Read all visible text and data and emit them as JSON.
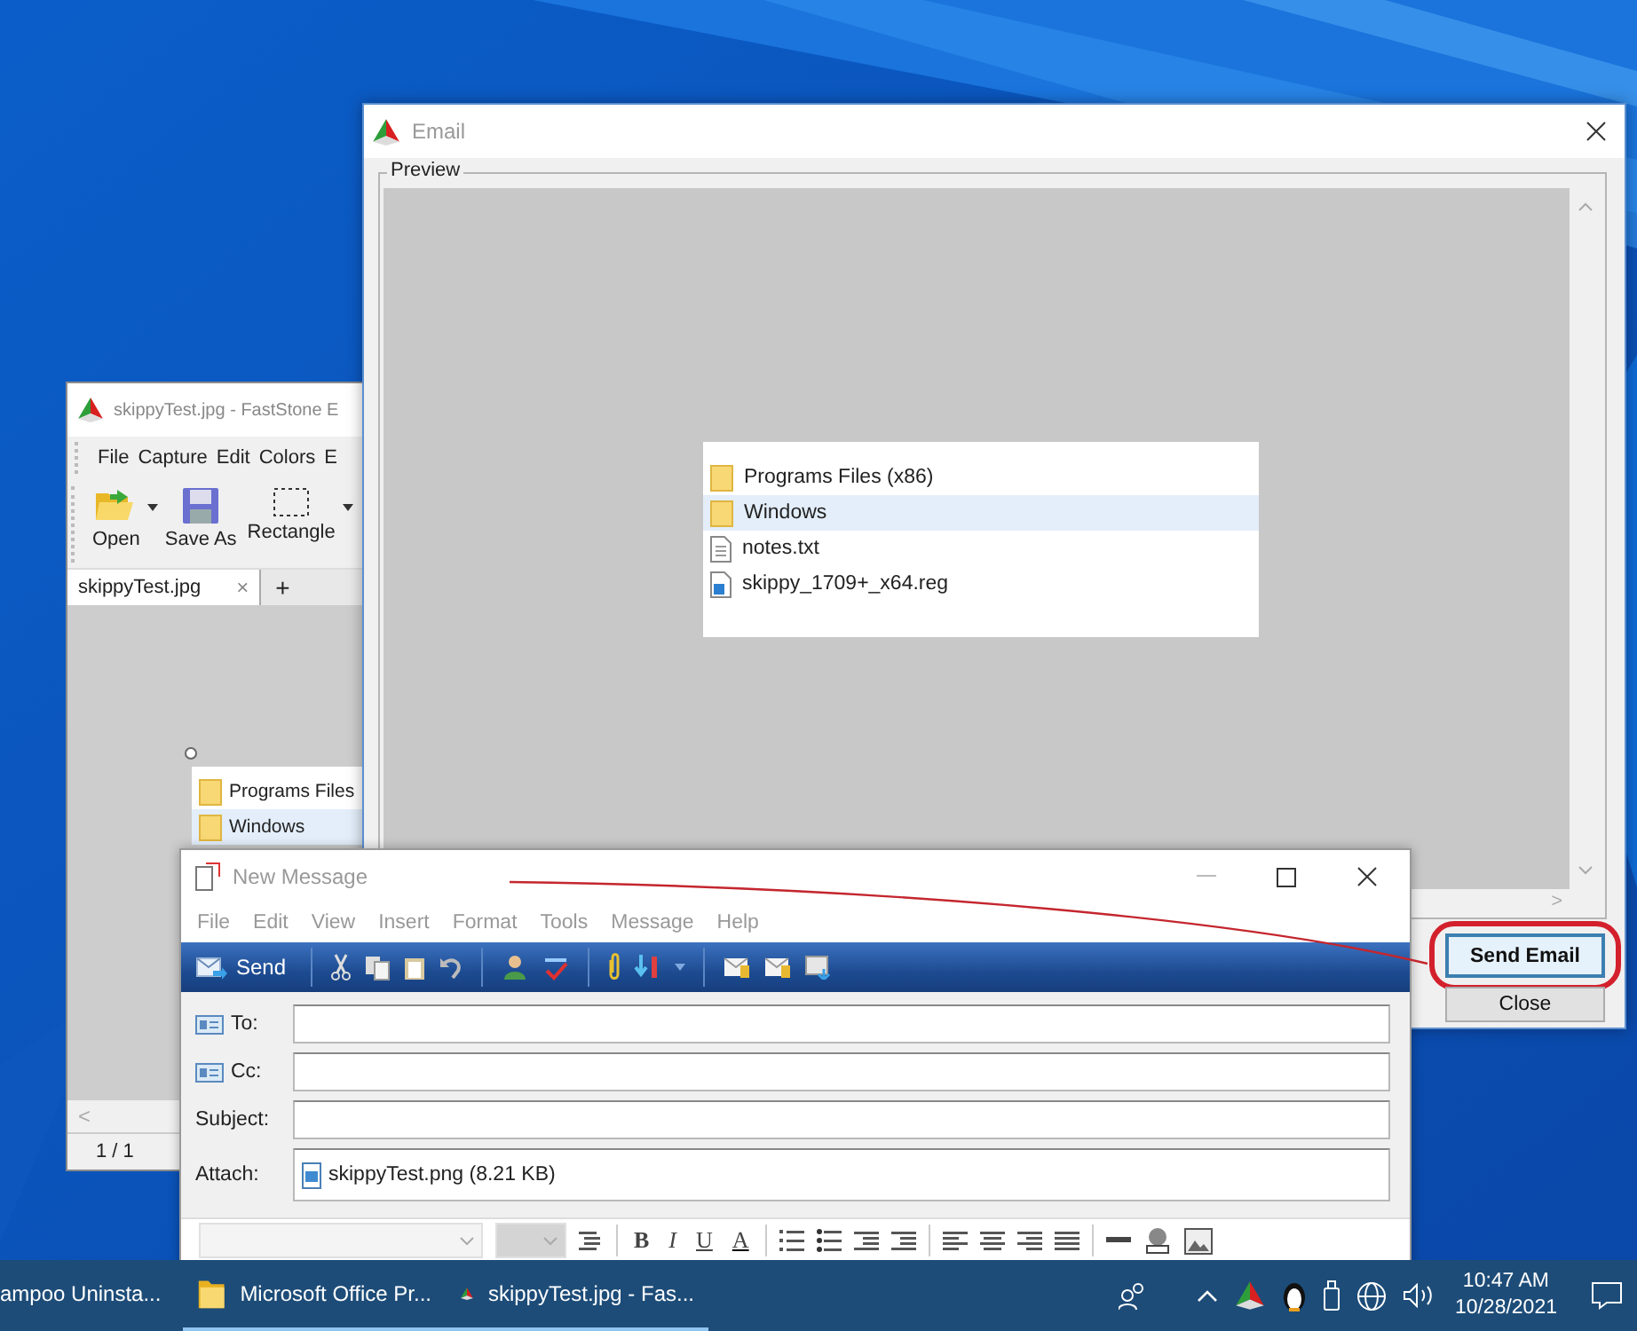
{
  "faststone_window": {
    "title": "skippyTest.jpg - FastStone E",
    "menu": [
      "File",
      "Capture",
      "Edit",
      "Colors",
      "E"
    ],
    "toolbar": [
      {
        "label": "Open",
        "kind": "open"
      },
      {
        "label": "Save As",
        "kind": "save"
      },
      {
        "label": "Rectangle",
        "kind": "rectangle"
      }
    ],
    "tabs": [
      {
        "label": "skippyTest.jpg",
        "close": "×",
        "selected": true
      }
    ],
    "new_tab": "+",
    "image_items": [
      {
        "label": "Programs Files",
        "kind": "folder",
        "selected": false
      },
      {
        "label": "Windows",
        "kind": "folder",
        "selected": true
      }
    ],
    "scroll_left": "<",
    "status": "1 / 1"
  },
  "email_window": {
    "title": "Email",
    "group_label": "Preview",
    "preview_items": [
      {
        "label": "Programs Files (x86)",
        "kind": "folder",
        "selected": false
      },
      {
        "label": "Windows",
        "kind": "folder",
        "selected": true
      },
      {
        "label": "notes.txt",
        "kind": "text_file",
        "selected": false
      },
      {
        "label": "skippy_1709+_x64.reg",
        "kind": "registry_file",
        "selected": false
      }
    ],
    "scroll_right": ">",
    "buttons": [
      {
        "label": "Send Email",
        "default": true,
        "circled": true
      },
      {
        "label": "Close",
        "default": false,
        "circled": false
      }
    ]
  },
  "message_window": {
    "title": "New Message",
    "menu": [
      "File",
      "Edit",
      "View",
      "Insert",
      "Format",
      "Tools",
      "Message",
      "Help"
    ],
    "send": "Send",
    "fields": [
      {
        "label": "To:",
        "kind": "address"
      },
      {
        "label": "Cc:",
        "kind": "address"
      },
      {
        "label": "Subject:",
        "kind": "text"
      },
      {
        "label": "Attach:",
        "kind": "attachment",
        "value": "skippyTest.png (8.21 KB)"
      }
    ],
    "format_buttons": [
      "B",
      "I",
      "U",
      "A"
    ]
  },
  "taskbar": {
    "apps": [
      {
        "label": "ampoo Uninsta...",
        "kind": "plain",
        "running": false
      },
      {
        "label": "Microsoft Office Pr...",
        "kind": "folder",
        "running": true
      },
      {
        "label": "skippyTest.jpg - Fas...",
        "kind": "faststone",
        "running": true
      }
    ],
    "time": "10:47 AM",
    "date": "10/28/2021"
  }
}
